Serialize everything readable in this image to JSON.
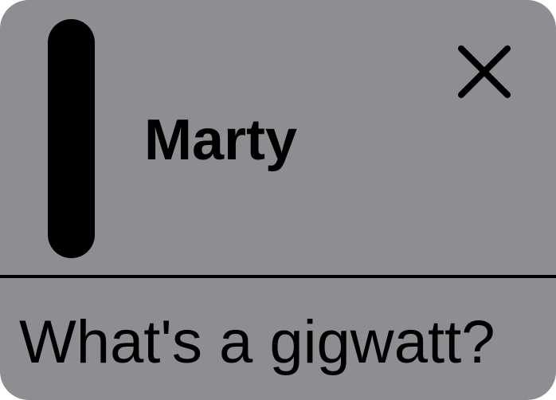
{
  "notification": {
    "sender": "Marty",
    "message": "What's a gigwatt?",
    "close_icon": "close-icon"
  },
  "colors": {
    "background": "#8e8d92",
    "foreground": "#000000"
  }
}
